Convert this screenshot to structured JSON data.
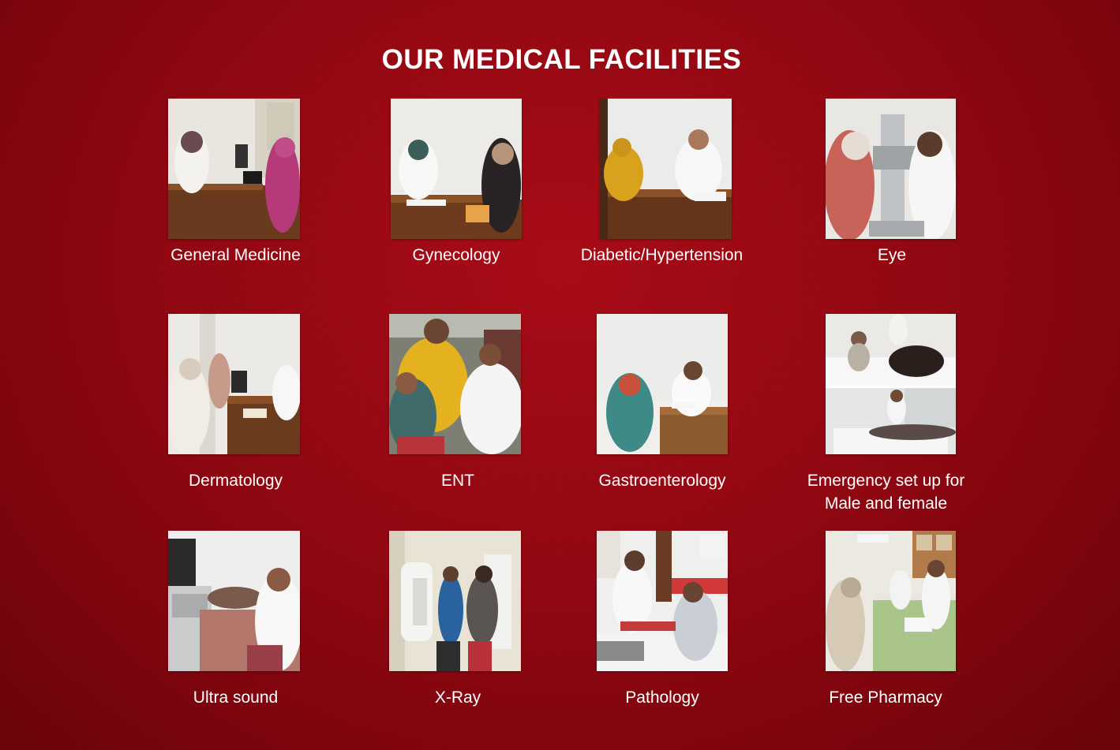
{
  "page": {
    "title": "OUR MEDICAL FACILITIES"
  },
  "facilities": [
    {
      "label": "General Medicine",
      "icon": "general-medicine-photo"
    },
    {
      "label": "Gynecology",
      "icon": "gynecology-photo"
    },
    {
      "label": "Diabetic/Hypertension",
      "icon": "diabetic-hypertension-photo"
    },
    {
      "label": "Eye",
      "icon": "eye-photo"
    },
    {
      "label": "Dermatology",
      "icon": "dermatology-photo"
    },
    {
      "label": "ENT",
      "icon": "ent-photo"
    },
    {
      "label": "Gastroenterology",
      "icon": "gastroenterology-photo"
    },
    {
      "label_line1": "Emergency set up for",
      "label_line2": "Male and female",
      "icon": "emergency-photo"
    },
    {
      "label": "Ultra sound",
      "icon": "ultrasound-photo"
    },
    {
      "label": "X-Ray",
      "icon": "xray-photo"
    },
    {
      "label": "Pathology",
      "icon": "pathology-photo"
    },
    {
      "label": "Free Pharmacy",
      "icon": "pharmacy-photo"
    }
  ],
  "colors": {
    "background": "#920812",
    "text": "#ffffff"
  }
}
